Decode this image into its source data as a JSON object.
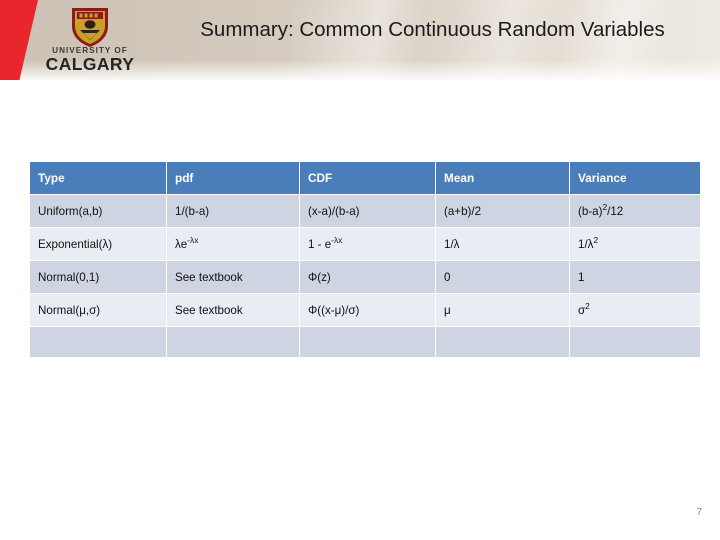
{
  "header": {
    "title": "Summary: Common Continuous Random Variables",
    "logo": {
      "line1": "UNIVERSITY OF",
      "line2": "CALGARY",
      "crest_icon": "shield-crest-icon"
    },
    "accent_red": "#e8262c",
    "band_color": "#d7cec1"
  },
  "table": {
    "header_color": "#4a7ebb",
    "row_odd_color": "#ced4e2",
    "row_even_color": "#e9ecf3",
    "columns": [
      "Type",
      "pdf",
      "CDF",
      "Mean",
      "Variance"
    ],
    "rows": [
      {
        "type": "Uniform(a,b)",
        "pdf": "1/(b-a)",
        "cdf": "(x-a)/(b-a)",
        "mean": "(a+b)/2",
        "variance_base": "(b-a)",
        "variance_sup": "2",
        "variance_tail": "/12"
      },
      {
        "type": "Exponential(λ)",
        "pdf_base": "λe",
        "pdf_sup": "-λx",
        "cdf_base": "1 - e",
        "cdf_sup": "-λx",
        "mean": "1/λ",
        "variance_base": "1/λ",
        "variance_sup": "2",
        "variance_tail": ""
      },
      {
        "type": "Normal(0,1)",
        "pdf": "See textbook",
        "cdf": "Φ(z)",
        "mean": "0",
        "variance": "1"
      },
      {
        "type": "Normal(μ,σ)",
        "pdf": "See textbook",
        "cdf": "Φ((x-μ)/σ)",
        "mean": "μ",
        "variance_base": "σ",
        "variance_sup": "2",
        "variance_tail": ""
      }
    ]
  },
  "footer": {
    "page_number": "7"
  }
}
